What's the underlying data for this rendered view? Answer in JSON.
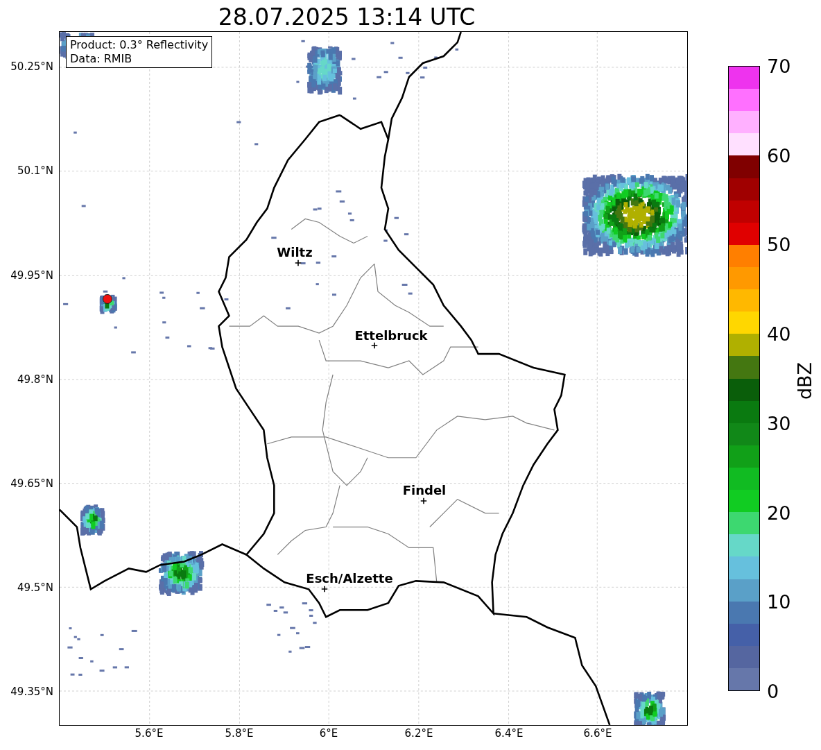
{
  "title": "28.07.2025 13:14 UTC",
  "info_box": [
    "Product: 0.3° Reflectivity",
    "Data: RMIB"
  ],
  "map": {
    "y_ticks": [
      "50.25°N",
      "50.1°N",
      "49.95°N",
      "49.8°N",
      "49.65°N",
      "49.5°N",
      "49.35°N"
    ],
    "x_ticks": [
      "5.6°E",
      "5.8°E",
      "6°E",
      "6.2°E",
      "6.4°E",
      "6.6°E"
    ],
    "places": [
      {
        "name": "Wiltz"
      },
      {
        "name": "Ettelbruck"
      },
      {
        "name": "Findel"
      },
      {
        "name": "Esch/Alzette"
      }
    ]
  },
  "colorbar": {
    "label": "dBZ",
    "ticks": [
      "70",
      "60",
      "50",
      "40",
      "30",
      "20",
      "10",
      "0"
    ],
    "bands": [
      {
        "color": "#ee33ee"
      },
      {
        "color": "#ff70ff"
      },
      {
        "color": "#ffb0ff"
      },
      {
        "color": "#ffe0ff"
      },
      {
        "color": "#800000"
      },
      {
        "color": "#a00000"
      },
      {
        "color": "#c00000"
      },
      {
        "color": "#e00000"
      },
      {
        "color": "#ff7f00"
      },
      {
        "color": "#ff9900"
      },
      {
        "color": "#ffb800"
      },
      {
        "color": "#ffd700"
      },
      {
        "color": "#b0b000"
      },
      {
        "color": "#447711"
      },
      {
        "color": "#0a5e0a"
      },
      {
        "color": "#0a7a10"
      },
      {
        "color": "#118818"
      },
      {
        "color": "#11a018"
      },
      {
        "color": "#11bb22"
      },
      {
        "color": "#11cc22"
      },
      {
        "color": "#3dd870"
      },
      {
        "color": "#66d8c8"
      },
      {
        "color": "#66c0dd"
      },
      {
        "color": "#5aa0c8"
      },
      {
        "color": "#4a78b0"
      },
      {
        "color": "#4560a8"
      },
      {
        "color": "#5566a0"
      },
      {
        "color": "#6677aa"
      }
    ]
  }
}
